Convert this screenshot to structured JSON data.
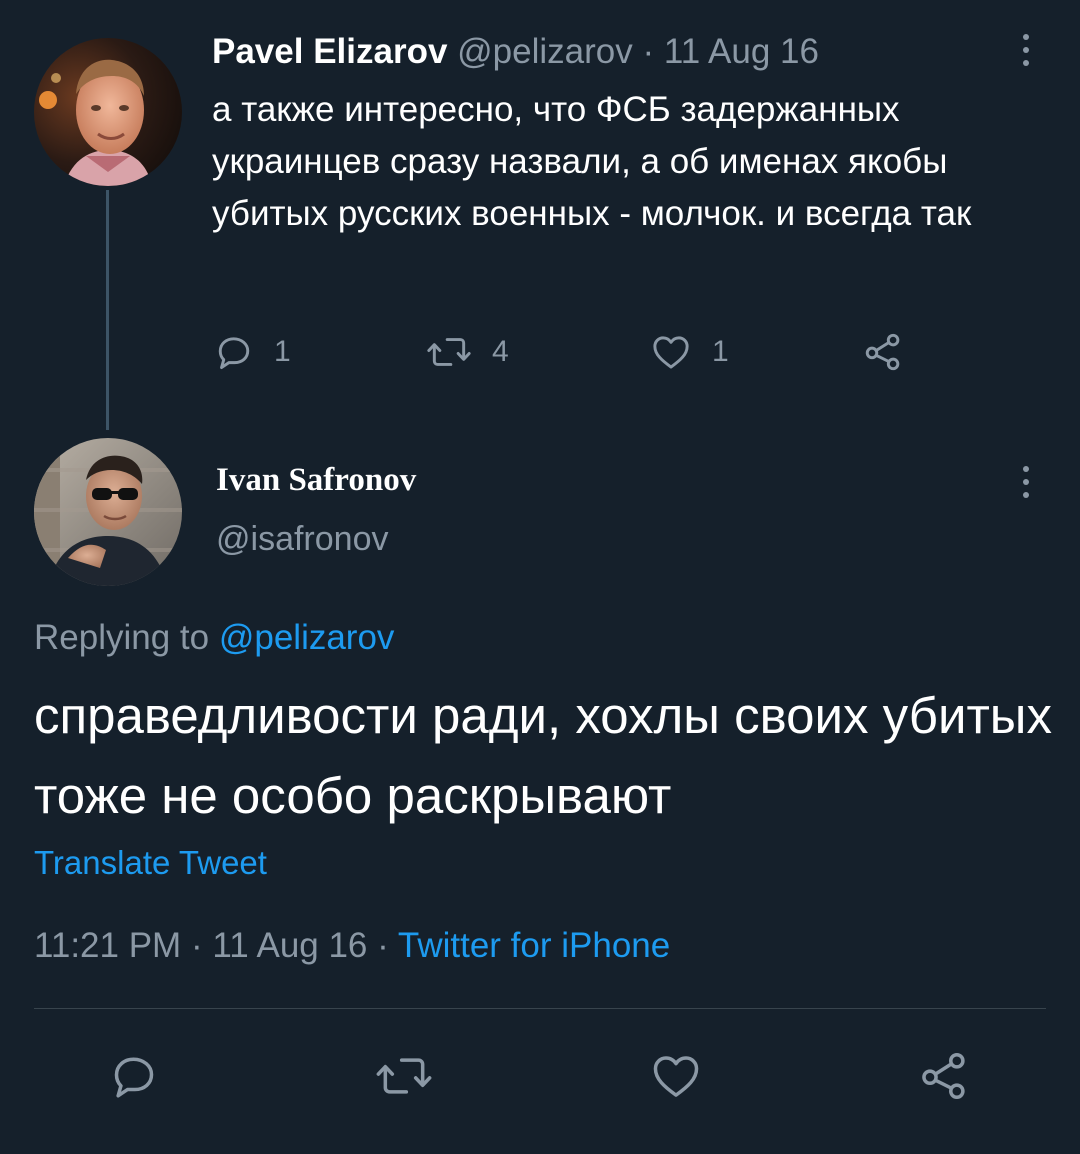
{
  "parent_tweet": {
    "author_name": "Pavel Elizarov",
    "handle": "@pelizarov",
    "separator": "·",
    "date": "11 Aug 16",
    "text": "а также интересно, что ФСБ задержанных украинцев сразу назвали, а об именах якобы убитых русских военных - молчок. и всегда так",
    "actions": {
      "reply_icon": "reply-bubble-icon",
      "reply_count": "1",
      "retweet_icon": "retweet-icon",
      "retweet_count": "4",
      "like_icon": "heart-icon",
      "like_count": "1",
      "share_icon": "share-icon"
    }
  },
  "reply_tweet": {
    "author_name": "Ivan Safronov",
    "handle": "@isafronov",
    "replying_to_label": "Replying to ",
    "replying_to_handle": "@pelizarov",
    "text": "справедливости ради, хохлы своих убитых тоже не особо раскрывают",
    "translate_label": "Translate Tweet",
    "time": "11:21 PM",
    "separator": "·",
    "date": "11 Aug 16",
    "source": "Twitter for iPhone"
  },
  "colors": {
    "background": "#15202b",
    "text_primary": "#ffffff",
    "text_secondary": "#8b98a5",
    "link": "#1d9bf0",
    "divider": "#38444d"
  }
}
